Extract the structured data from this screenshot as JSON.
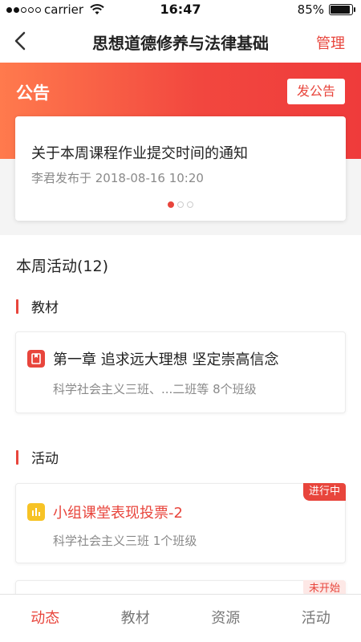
{
  "status_bar": {
    "carrier": "carrier",
    "time": "16:47",
    "battery": "85%"
  },
  "nav": {
    "title": "思想道德修养与法律基础",
    "manage": "管理"
  },
  "announcement": {
    "label": "公告",
    "post_button": "发公告",
    "title": "关于本周课程作业提交时间的通知",
    "meta": "李君发布于  2018-08-16 10:20",
    "pages": 3,
    "current_page": 1
  },
  "week": {
    "title": "本周活动(12)"
  },
  "sections": {
    "textbook": {
      "label": "教材",
      "title": "第一章 追求远大理想 坚定崇高信念",
      "sub": "科学社会主义三班、...二班等  8个班级"
    },
    "activity": {
      "label": "活动",
      "cards": [
        {
          "title": "小组课堂表现投票-2",
          "sub": "科学社会主义三班  1个班级",
          "badge": "进行中"
        },
        {
          "badge": "未开始"
        }
      ]
    }
  },
  "tabs": [
    "动态",
    "教材",
    "资源",
    "活动"
  ],
  "colors": {
    "accent": "#e8453c",
    "icon_yellow": "#f7c325"
  }
}
